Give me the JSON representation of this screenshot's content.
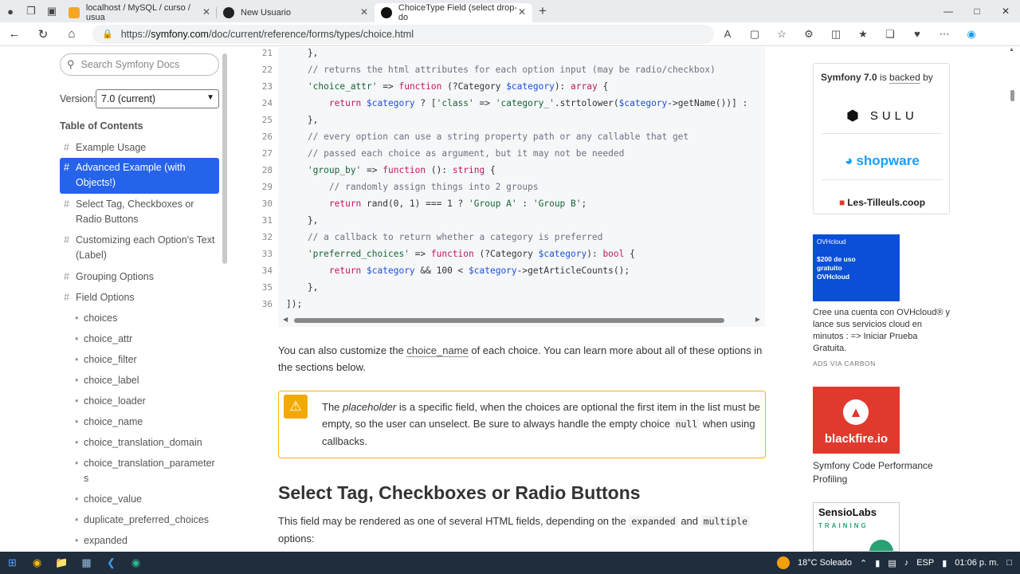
{
  "browser": {
    "tabs": [
      {
        "title": "localhost / MySQL / curso / usua",
        "icon": "phpmyadmin-icon"
      },
      {
        "title": "New Usuario",
        "icon": "github-icon"
      },
      {
        "title": "ChoiceType Field (select drop-do",
        "icon": "symfony-icon"
      }
    ],
    "new_tab": "+",
    "url_prefix": "https://",
    "url_domain": "symfony.com",
    "url_path": "/doc/current/reference/forms/types/choice.html"
  },
  "sidebar": {
    "search_placeholder": "Search Symfony Docs",
    "version_label": "Version:",
    "version_value": "7.0 (current)",
    "toc_title": "Table of Contents",
    "toc_items": [
      {
        "label": "Example Usage"
      },
      {
        "label": "Advanced Example (with Objects!)"
      },
      {
        "label": "Select Tag, Checkboxes or Radio Buttons"
      },
      {
        "label": "Customizing each Option's Text (Label)"
      },
      {
        "label": "Grouping Options"
      },
      {
        "label": "Field Options"
      }
    ],
    "toc_sub_items": [
      "choices",
      "choice_attr",
      "choice_filter",
      "choice_label",
      "choice_loader",
      "choice_name",
      "choice_translation_domain",
      "choice_translation_parameters",
      "choice_value",
      "duplicate_preferred_choices",
      "expanded"
    ]
  },
  "code": {
    "line_numbers": [
      "21",
      "22",
      "23",
      "24",
      "25",
      "26",
      "27",
      "28",
      "29",
      "30",
      "31",
      "32",
      "33",
      "34",
      "35",
      "36"
    ],
    "lines": [
      {
        "p": [
          {
            "t": "    },",
            "c": ""
          }
        ]
      },
      {
        "p": [
          {
            "t": "    // returns the html attributes for each option input (may be radio/checkbox)",
            "c": "cm"
          }
        ]
      },
      {
        "p": [
          {
            "t": "    'choice_attr'",
            "c": "str"
          },
          {
            "t": " => ",
            "c": ""
          },
          {
            "t": "function",
            "c": "kw"
          },
          {
            "t": " (?Category ",
            "c": ""
          },
          {
            "t": "$category",
            "c": "var"
          },
          {
            "t": "): ",
            "c": ""
          },
          {
            "t": "array",
            "c": "kw"
          },
          {
            "t": " {",
            "c": ""
          }
        ]
      },
      {
        "p": [
          {
            "t": "        return ",
            "c": "kw"
          },
          {
            "t": "$category",
            "c": "var"
          },
          {
            "t": " ? [",
            "c": ""
          },
          {
            "t": "'class'",
            "c": "str"
          },
          {
            "t": " => ",
            "c": ""
          },
          {
            "t": "'category_'",
            "c": "str"
          },
          {
            "t": ".strtolower(",
            "c": ""
          },
          {
            "t": "$category",
            "c": "var"
          },
          {
            "t": "->getName())] :",
            "c": ""
          }
        ]
      },
      {
        "p": [
          {
            "t": "    },",
            "c": ""
          }
        ]
      },
      {
        "p": [
          {
            "t": "    // every option can use a string property path or any callable that get",
            "c": "cm"
          }
        ]
      },
      {
        "p": [
          {
            "t": "    // passed each choice as argument, but it may not be needed",
            "c": "cm"
          }
        ]
      },
      {
        "p": [
          {
            "t": "    'group_by'",
            "c": "str"
          },
          {
            "t": " => ",
            "c": ""
          },
          {
            "t": "function",
            "c": "kw"
          },
          {
            "t": " (): ",
            "c": ""
          },
          {
            "t": "string",
            "c": "kw"
          },
          {
            "t": " {",
            "c": ""
          }
        ]
      },
      {
        "p": [
          {
            "t": "        // randomly assign things into 2 groups",
            "c": "cm"
          }
        ]
      },
      {
        "p": [
          {
            "t": "        return ",
            "c": "kw"
          },
          {
            "t": "rand(0, 1) === 1 ? ",
            "c": ""
          },
          {
            "t": "'Group A'",
            "c": "str"
          },
          {
            "t": " : ",
            "c": ""
          },
          {
            "t": "'Group B'",
            "c": "str"
          },
          {
            "t": ";",
            "c": ""
          }
        ]
      },
      {
        "p": [
          {
            "t": "    },",
            "c": ""
          }
        ]
      },
      {
        "p": [
          {
            "t": "    // a callback to return whether a category is preferred",
            "c": "cm"
          }
        ]
      },
      {
        "p": [
          {
            "t": "    'preferred_choices'",
            "c": "str"
          },
          {
            "t": " => ",
            "c": ""
          },
          {
            "t": "function",
            "c": "kw"
          },
          {
            "t": " (?Category ",
            "c": ""
          },
          {
            "t": "$category",
            "c": "var"
          },
          {
            "t": "): ",
            "c": ""
          },
          {
            "t": "bool",
            "c": "kw"
          },
          {
            "t": " {",
            "c": ""
          }
        ]
      },
      {
        "p": [
          {
            "t": "        return ",
            "c": "kw"
          },
          {
            "t": "$category",
            "c": "var"
          },
          {
            "t": " && 100 < ",
            "c": ""
          },
          {
            "t": "$category",
            "c": "var"
          },
          {
            "t": "->getArticleCounts();",
            "c": ""
          }
        ]
      },
      {
        "p": [
          {
            "t": "    },",
            "c": ""
          }
        ]
      },
      {
        "p": [
          {
            "t": "]);",
            "c": ""
          }
        ]
      }
    ]
  },
  "content": {
    "para1_a": "You can also customize the ",
    "para1_link": "choice_name",
    "para1_b": " of each choice. You can learn more about all of these options in the sections below.",
    "callout_a": "The ",
    "callout_em": "placeholder",
    "callout_b": " is a specific field, when the choices are optional the first item in the list must be empty, so the user can unselect. Be sure to always handle the empty choice ",
    "callout_code": "null",
    "callout_c": " when using callbacks.",
    "heading": "Select Tag, Checkboxes or Radio Buttons",
    "para2_a": "This field may be rendered as one of several HTML fields, depending on the ",
    "para2_code1": "expanded",
    "para2_and": " and ",
    "para2_code2": "multiple",
    "para2_b": " options:"
  },
  "right": {
    "sponsor_version": "Symfony 7.0",
    "sponsor_is": " is ",
    "sponsor_backed": "backed",
    "sponsor_by": " by",
    "sponsors": [
      "SULU",
      "shopware",
      "Les-Tilleuls.coop"
    ],
    "ovh_brand": "OVHcloud",
    "ovh_ad": "$200 de uso gratuito OVHcloud",
    "ovh_text": "Cree una cuenta con OVHcloud® y lance sus servicios cloud en minutos : => Iniciar Prueba Gratuita.",
    "carbon": "ADS VIA CARBON",
    "blackfire": "blackfire.io",
    "blackfire_text": "Symfony Code Performance Profiling",
    "sensio": "SensioLabs",
    "sensio_sub": "TRAINING"
  },
  "taskbar": {
    "weather": "18°C  Soleado",
    "lang": "ESP",
    "time": "01:06 p. m."
  }
}
